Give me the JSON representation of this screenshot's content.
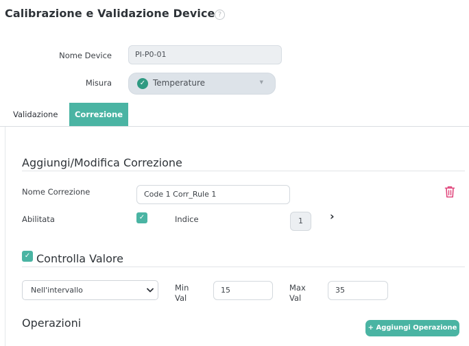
{
  "page": {
    "title": "Calibrazione e Validazione Device",
    "help_icon": "?"
  },
  "form": {
    "device_label": "Nome Device",
    "device_value": "PI-P0-01",
    "measure_label": "Misura",
    "measure_value": "Temperature"
  },
  "tabs": [
    {
      "label": "Validazione",
      "active": false
    },
    {
      "label": "Correzione",
      "active": true
    }
  ],
  "correction": {
    "section_title": "Aggiungi/Modifica Correzione",
    "name_label": "Nome Correzione",
    "name_value": "Code 1 Corr_Rule 1",
    "enabled_label": "Abilitata",
    "enabled_checked": true,
    "index_label": "Indice",
    "index_value": "1"
  },
  "check_value": {
    "title": "Controlla Valore",
    "checked": true,
    "range_select": "Nell'intervallo",
    "min_label_line1": "Min",
    "min_label_line2": "Val",
    "min_value": "15",
    "max_label_line1": "Max",
    "max_label_line2": "Val",
    "max_value": "35"
  },
  "operations": {
    "title": "Operazioni",
    "add_button_label": "Aggiungi Operazione",
    "add_button_icon": "+"
  },
  "colors": {
    "accent": "#4ab4a3",
    "delete": "#e0457b"
  }
}
